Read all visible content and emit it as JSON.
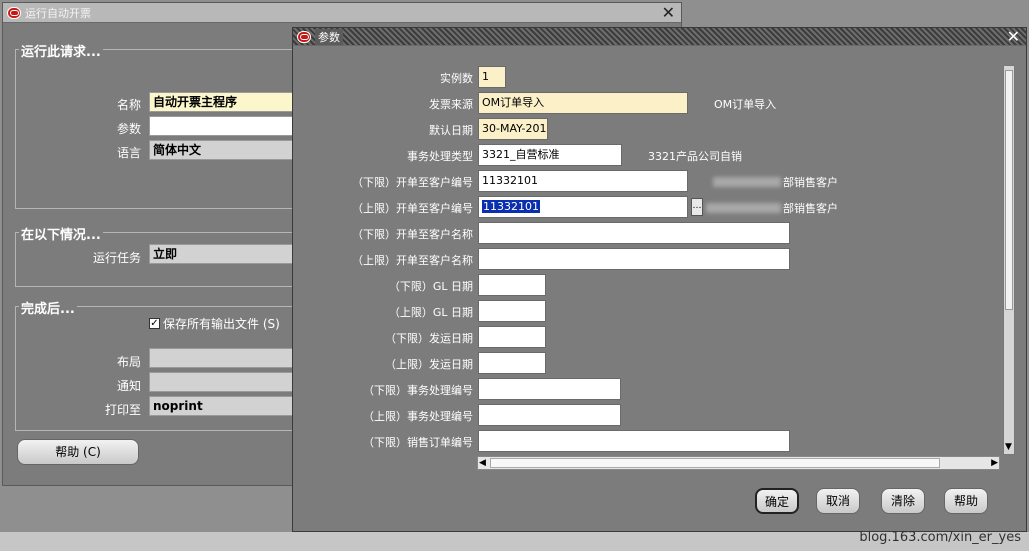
{
  "back_window": {
    "title": "运行自动开票",
    "run_request": {
      "heading": "运行此请求...",
      "name_label": "名称",
      "name_value": "自动开票主程序",
      "params_label": "参数",
      "params_value": "",
      "language_label": "语言",
      "language_value": "简体中文"
    },
    "conditions": {
      "heading": "在以下情况...",
      "run_task_label": "运行任务",
      "run_task_value": "立即"
    },
    "after": {
      "heading": "完成后...",
      "save_outputs_label": "保存所有输出文件 (S)",
      "save_outputs_checked": true,
      "layout_label": "布局",
      "layout_value": "",
      "notify_label": "通知",
      "notify_value": "",
      "print_to_label": "打印至",
      "print_to_value": "noprint"
    },
    "help_button": "帮助 (C)"
  },
  "params_dialog": {
    "title": "参数",
    "fields": [
      {
        "label": "实例数",
        "value": "1",
        "desc": ""
      },
      {
        "label": "发票来源",
        "value": "OM订单导入",
        "desc": "OM订单导入"
      },
      {
        "label": "默认日期",
        "value": "30-MAY-201",
        "desc": ""
      },
      {
        "label": "事务处理类型",
        "value": "3321_自营标准",
        "desc": "3321产品公司自销"
      },
      {
        "label": "（下限）开单至客户编号",
        "value": "11332101",
        "desc": "部销售客户"
      },
      {
        "label": "（上限）开单至客户编号",
        "value": "11332101",
        "desc": "部销售客户"
      },
      {
        "label": "（下限）开单至客户名称",
        "value": "",
        "desc": ""
      },
      {
        "label": "（上限）开单至客户名称",
        "value": "",
        "desc": ""
      },
      {
        "label": "（下限）GL 日期",
        "value": "",
        "desc": ""
      },
      {
        "label": "（上限）GL 日期",
        "value": "",
        "desc": ""
      },
      {
        "label": "（下限）发运日期",
        "value": "",
        "desc": ""
      },
      {
        "label": "（上限）发运日期",
        "value": "",
        "desc": ""
      },
      {
        "label": "（下限）事务处理编号",
        "value": "",
        "desc": ""
      },
      {
        "label": "（上限）事务处理编号",
        "value": "",
        "desc": ""
      },
      {
        "label": "（下限）销售订单编号",
        "value": "",
        "desc": ""
      }
    ],
    "buttons": {
      "ok": "确定",
      "cancel": "取消",
      "clear": "清除",
      "help": "帮助"
    }
  },
  "watermark": "blog.163.com/xin_er_yes"
}
